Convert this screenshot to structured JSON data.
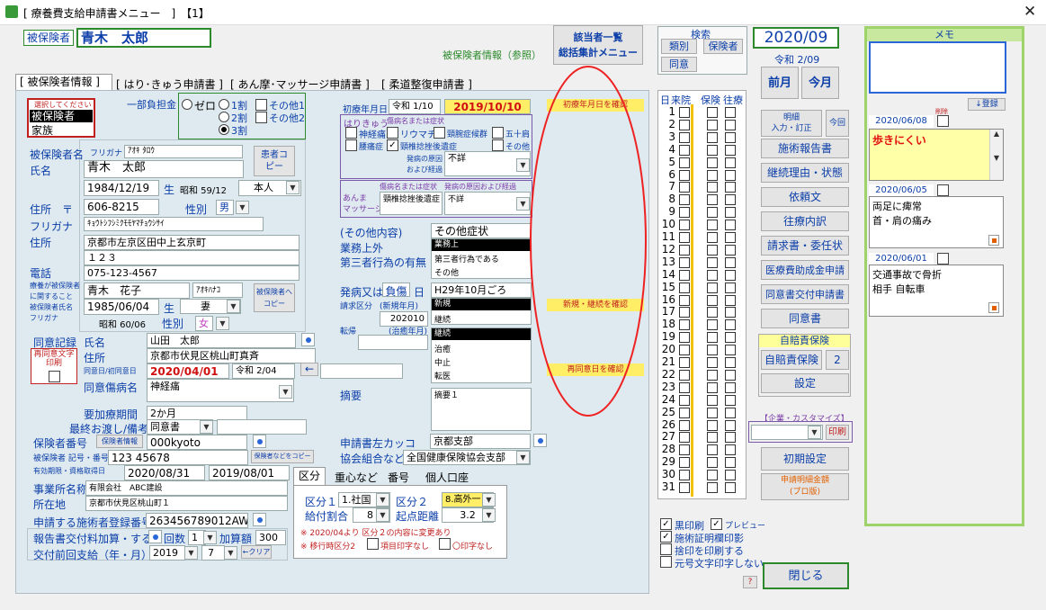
{
  "window": {
    "title": "[ 療養費支給申請書メニュー　]　【1】"
  },
  "header": {
    "insured_label": "被保険者",
    "insured_name": "青木　太郎",
    "insured_ref": "被保険者情報（参照）",
    "list_btn1": "該当者一覧",
    "list_btn2": "総括集計メニュー",
    "search_label": "検索",
    "search_kind": "類別",
    "search_insurer": "保険者",
    "search_same": "同意",
    "year_month": "2020/09",
    "wareki": "令和 2/09",
    "prev_month": "前月",
    "this_month": "今月"
  },
  "tabs": [
    "[ 被保険者情報 ]",
    "[ はり･きゅう申請書 ]",
    "[ あん摩･マッサージ申請書 ]",
    "[ 柔道整復申請書 ]"
  ],
  "left": {
    "select_prompt": "選択してください",
    "list_items": [
      "被保険者",
      "家族"
    ],
    "list_selected": "被保険者",
    "futan_label": "一部負担金",
    "zero": "ゼロ",
    "wari1": "1割",
    "wari2": "2割",
    "wari3": "3割",
    "other1": "その他1",
    "other2": "その他2",
    "hihoken_label": "被保険者名",
    "furigana_small": "フリガナ",
    "furigana": "ｱｵｷ ﾀﾛｳ",
    "name_label": "氏名",
    "name": "青木　太郎",
    "kanja_copy": "患者コピー",
    "birth": "1984/12/19",
    "sei": "生",
    "birth_wareki": "昭和 59/12",
    "relation": "本人",
    "address_label": "住所　〒",
    "zip": "606-8215",
    "sex_label": "性別",
    "sex": "男",
    "kana_label": "フリガナ",
    "kana_addr": "ｷｮｳﾄｼﾌｼﾐｸﾓﾓﾔﾏﾁｮｳｼｻｲ",
    "addr_label": "住所",
    "addr1": "京都市左京区田中上玄京町",
    "addr2": "１２３",
    "tel_label": "電話",
    "tel": "075-123-4567",
    "kazoku_label1": "療養が被保険者",
    "kazoku_label2": "に関すること",
    "kazoku_label3": "被保険者氏名",
    "kazoku_label4": "フリガナ",
    "kazoku_name": "青木　花子",
    "kazoku_kana": "ｱｵｷﾊﾅｺ",
    "kazoku_copy": "被保険者へコピー",
    "kazoku_birth": "1985/06/04",
    "kazoku_wareki": "昭和 60/06",
    "kazoku_rel": "妻",
    "kazoku_sex": "女",
    "doi_label": "同意記録",
    "doi_name_label": "氏名",
    "doi_name": "山田　太郎",
    "doi_addr_label": "住所",
    "doi_addr": "京都市伏見区桃山町真斉",
    "reprint": "再同意文字印刷",
    "doi_date_label": "同意日/初同意日",
    "doi_date": "2020/04/01",
    "doi_wareki": "令和 2/04",
    "doi_disease_label": "同意傷病名",
    "doi_disease": "神経痛",
    "kaoryo_label": "要加療期間",
    "kaoryo": "2か月",
    "saishu_label": "最終お渡し/備考",
    "saishu": "同意書",
    "hoken_no_label": "保険者番号",
    "hoken_info": "保険者情報",
    "hoken_no": "000kyoto",
    "kigou_label": "被保険者 記号・番号",
    "kigou": "123 45678",
    "kigou_copy": "保険者などをコピー",
    "yuko_label": "有効期限・資格取得日",
    "yuko1": "2020/08/31",
    "yuko2": "2019/08/01",
    "jigyo_label": "事業所名称",
    "jigyo": "有限会社　ABC建設",
    "shozai_label": "所在地",
    "shozai": "京都市伏見区桃山町１",
    "sejutsu_label": "申請する施術者登録番号",
    "sejutsu": "263456789012AW",
    "houkoku_label": "報告書交付料加算・する",
    "kaisu": "回数",
    "kaisu_val": "1",
    "kasan": "加算額",
    "kasan_val": "300",
    "zenkai_label": "交付前回支給（年・月）",
    "zenkai_y": "2019",
    "zenkai_m": "7",
    "clear": "←クリア"
  },
  "mid": {
    "shoken_label": "初療年月日",
    "shoken_wareki": "令和 1/10",
    "shoken": "2019/10/10",
    "hari_label": "はりきゅう",
    "hari_sub": "傷病名または症状",
    "c_shinkei": "神経痛",
    "c_reuma": "リウマチ",
    "c_keiwan": "頸腕症候群",
    "c_gojukata": "五十肩",
    "c_yotsu": "腰痛症",
    "c_keitsui": "頸椎捻挫後遺症",
    "c_sonota": "その他",
    "hassho_label1": "発病の原因",
    "hassho_label2": "および経過",
    "hassho": "不詳",
    "anma_label1": "あんま",
    "anma_label2": "マッサージ",
    "anma_sub": "傷病名または症状　発病の原因および経過",
    "anma_disease": "頸椎捻挫後遺症",
    "anma_cause": "不詳",
    "sonota_label": "(その他内容)",
    "sonota": "その他症状",
    "gyomu_label": "業務上外",
    "daisan_label": "第三者行為の有無",
    "gyomu_list": [
      "業務上",
      "第三者行為である",
      "その他"
    ],
    "hassho_date_label": "発病又は",
    "fusho": "負傷",
    "hi": "日",
    "hassho_date": "H29年10月ごろ",
    "shinki_label": "請求区分",
    "shinki_sub": "(新規年月)",
    "shinki_list": [
      "新規",
      "継続"
    ],
    "shinki_date": "202010",
    "tenki_label": "転帰",
    "tenki_sub": "(治癒年月)",
    "tenki_list": [
      "継続",
      "治癒",
      "中止",
      "転医"
    ],
    "tekiyo_label": "摘要",
    "tekiyo": "摘要１",
    "kakko_label": "申請書左カッコ",
    "kakko": "京都支部",
    "kyokai_label": "協会組合など",
    "kyokai": "全国健康保険協会支部",
    "subtabs": [
      "区分",
      "重心など",
      "番号",
      "個人口座"
    ],
    "kubun1_label": "区分１",
    "kubun1": "1.社国",
    "kubun2_label": "区分２",
    "kubun2": "8.高外一",
    "kyufu_label": "給付割合",
    "kyufu": "8",
    "kiten_label": "起点距離",
    "kiten": "3.2",
    "note1": "※ 2020/04より 区分２の内容に変更あり",
    "note2": "※ 移行時区分2",
    "note_a": "項目印字なし",
    "note_b": "〇印字なし"
  },
  "warnings": {
    "w1": "初療年月日を確認",
    "w2": "新規・継続を確認",
    "w3": "再同意日を確認"
  },
  "days": {
    "h_day": "日",
    "h_visit": "来院",
    "h_ins": "保険",
    "h_trip": "往療",
    "list": [
      "1",
      "2",
      "3",
      "4",
      "5",
      "6",
      "7",
      "8",
      "9",
      "10",
      "11",
      "12",
      "13",
      "14",
      "15",
      "16",
      "17",
      "18",
      "19",
      "20",
      "21",
      "22",
      "23",
      "24",
      "25",
      "26",
      "27",
      "28",
      "29",
      "30",
      "31"
    ]
  },
  "right": {
    "meisai": "明細\n入力・訂正",
    "konkai": "今回",
    "btn1": "施術報告書",
    "btn2": "継続理由・状態",
    "btn3": "依頼文",
    "btn4": "往療内訳",
    "btn5": "請求書・委任状",
    "btn6": "医療費助成金申請",
    "btn7": "同意書交付申請書",
    "btn8": "同意書",
    "jibai_title": "自賠責保険",
    "jibai_btn": "自賠責保険",
    "jibai_num": "2",
    "settei": "設定",
    "custom_label": "【企業・カスタマイズ】",
    "print": "印刷",
    "init": "初期設定",
    "sum1": "申請明細金額",
    "sum2": "(プロ版)",
    "opt1": "黒印刷",
    "opt_preview": "プレビュー",
    "opt2": "施術証明欄印影",
    "opt3": "捨印を印刷する",
    "opt4": "元号文字印字しない",
    "help": "?",
    "close": "閉じる"
  },
  "memo": {
    "title": "メモ",
    "register": "↓登録",
    "delete": "削除",
    "entries": [
      {
        "date": "2020/06/08",
        "text": "歩きにくい"
      },
      {
        "date": "2020/06/05",
        "text": "両足に痺常\n首・肩の痛み"
      },
      {
        "date": "2020/06/01",
        "text": "交通事故で骨折\n相手 自転車"
      }
    ]
  },
  "colors": {
    "accent": "#0b3ea8",
    "memo_border": "#9ed36a",
    "warning_bg": "#ffee66",
    "date_red": "#d01010"
  }
}
